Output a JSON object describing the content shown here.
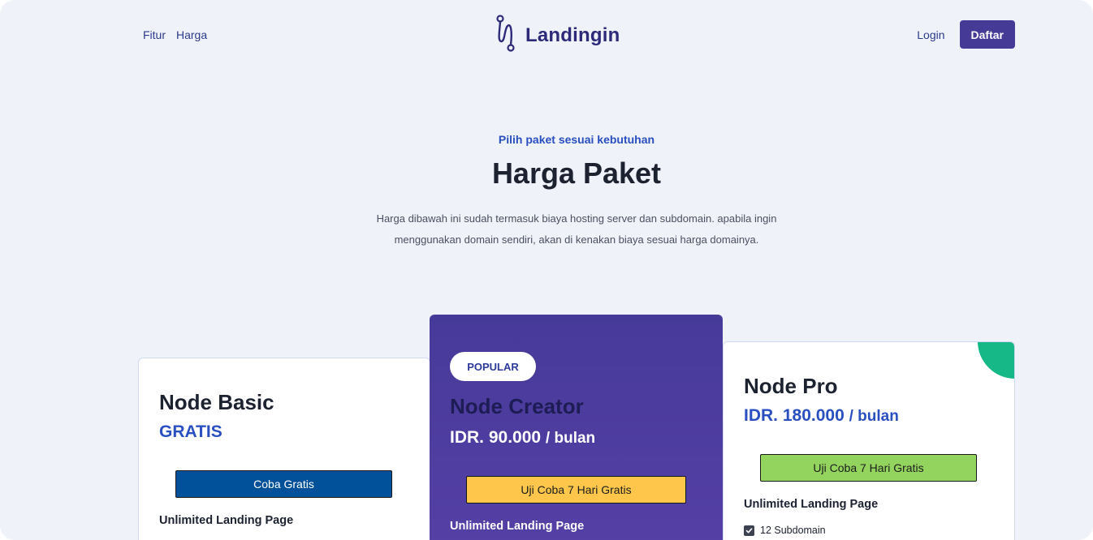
{
  "nav": {
    "links": [
      "Fitur",
      "Harga"
    ],
    "logo_text": "Landingin",
    "login_label": "Login",
    "register_label": "Daftar"
  },
  "hero": {
    "eyebrow": "Pilih paket sesuai kebutuhan",
    "title": "Harga Paket",
    "description": "Harga dibawah ini sudah termasuk biaya hosting server dan subdomain. apabila ingin menggunakan domain sendiri, akan di kenakan biaya sesuai harga domainya."
  },
  "plans": {
    "basic": {
      "name": "Node Basic",
      "price": "GRATIS",
      "button_label": "Coba Gratis",
      "feature_title": "Unlimited Landing Page"
    },
    "creator": {
      "badge": "POPULAR",
      "name": "Node Creator",
      "price": "IDR. 90.000",
      "period": "/ bulan",
      "button_label": "Uji Coba 7 Hari Gratis",
      "feature_title": "Unlimited Landing Page"
    },
    "pro": {
      "name": "Node Pro",
      "price": "IDR. 180.000",
      "period": "/ bulan",
      "button_label": "Uji Coba 7 Hari Gratis",
      "feature_title": "Unlimited Landing Page",
      "features": [
        "12 Subdomain"
      ]
    }
  },
  "colors": {
    "page_background": "#eff2f8",
    "brand_primary": "#463a97",
    "accent_blue": "#2a4fc0",
    "basic_button": "#00509a",
    "creator_button": "#fec74b",
    "pro_button": "#93d45e",
    "pro_corner": "#16b887"
  },
  "icons": {
    "logo": "landingin-logo-icon",
    "feature_check": "checkbox-checked-icon"
  }
}
